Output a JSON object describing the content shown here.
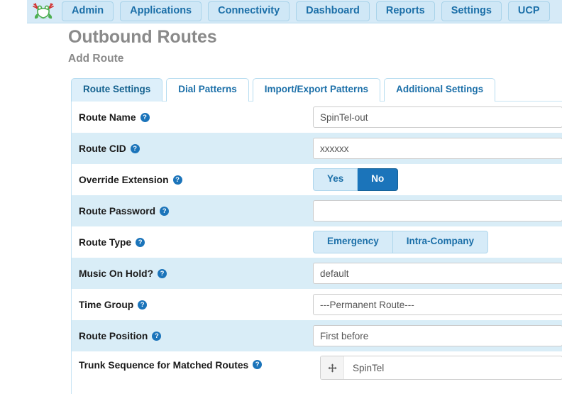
{
  "navbar": {
    "logo_name": "freepbx-frog-logo",
    "items": [
      {
        "label": "Admin",
        "name": "nav-admin"
      },
      {
        "label": "Applications",
        "name": "nav-applications"
      },
      {
        "label": "Connectivity",
        "name": "nav-connectivity"
      },
      {
        "label": "Dashboard",
        "name": "nav-dashboard"
      },
      {
        "label": "Reports",
        "name": "nav-reports"
      },
      {
        "label": "Settings",
        "name": "nav-settings"
      },
      {
        "label": "UCP",
        "name": "nav-ucp"
      }
    ]
  },
  "header": {
    "title": "Outbound Routes",
    "subtitle": "Add Route"
  },
  "tabs": [
    {
      "label": "Route Settings",
      "active": true
    },
    {
      "label": "Dial Patterns",
      "active": false
    },
    {
      "label": "Import/Export Patterns",
      "active": false
    },
    {
      "label": "Additional Settings",
      "active": false
    }
  ],
  "form": {
    "route_name": {
      "label": "Route Name",
      "value": "SpinTel-out",
      "help_icon": "question-mark-icon"
    },
    "route_cid": {
      "label": "Route CID",
      "value": "xxxxxx",
      "help_icon": "question-mark-icon"
    },
    "override_extension": {
      "label": "Override Extension",
      "options": [
        "Yes",
        "No"
      ],
      "selected": "No",
      "help_icon": "question-mark-icon"
    },
    "route_password": {
      "label": "Route Password",
      "value": "",
      "help_icon": "question-mark-icon"
    },
    "route_type": {
      "label": "Route Type",
      "options": [
        "Emergency",
        "Intra-Company"
      ],
      "selected": "",
      "help_icon": "question-mark-icon"
    },
    "music_on_hold": {
      "label": "Music On Hold?",
      "value": "default",
      "help_icon": "question-mark-icon"
    },
    "time_group": {
      "label": "Time Group",
      "value": "---Permanent Route---",
      "help_icon": "question-mark-icon"
    },
    "route_position": {
      "label": "Route Position",
      "value": "First before",
      "help_icon": "question-mark-icon"
    },
    "trunk_sequence": {
      "label": "Trunk Sequence for Matched Routes",
      "help_icon": "question-mark-icon",
      "items": [
        {
          "name": "SpinTel",
          "handle_icon": "move-arrows-icon"
        }
      ]
    }
  },
  "colors": {
    "nav_bg": "#d6eaf7",
    "nav_btn_bg": "#cfe7f6",
    "brand_blue": "#1b6fa8",
    "selected_blue": "#1b74ba",
    "row_stripe": "#d9edf7",
    "heading_gray": "#8a8a8a"
  }
}
